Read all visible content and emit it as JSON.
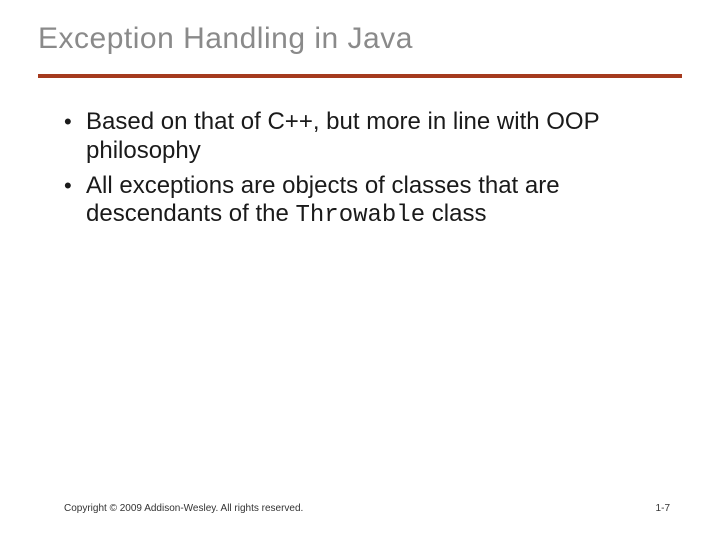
{
  "title": "Exception Handling in Java",
  "bullets": [
    {
      "pre": "Based on that of C++, but more in line with OOP philosophy",
      "code": "",
      "post": ""
    },
    {
      "pre": "All exceptions are objects of classes that are descendants of the ",
      "code": "Throwable",
      "post": " class"
    }
  ],
  "footer": {
    "copyright": "Copyright © 2009 Addison-Wesley. All rights reserved.",
    "page": "1-7"
  }
}
